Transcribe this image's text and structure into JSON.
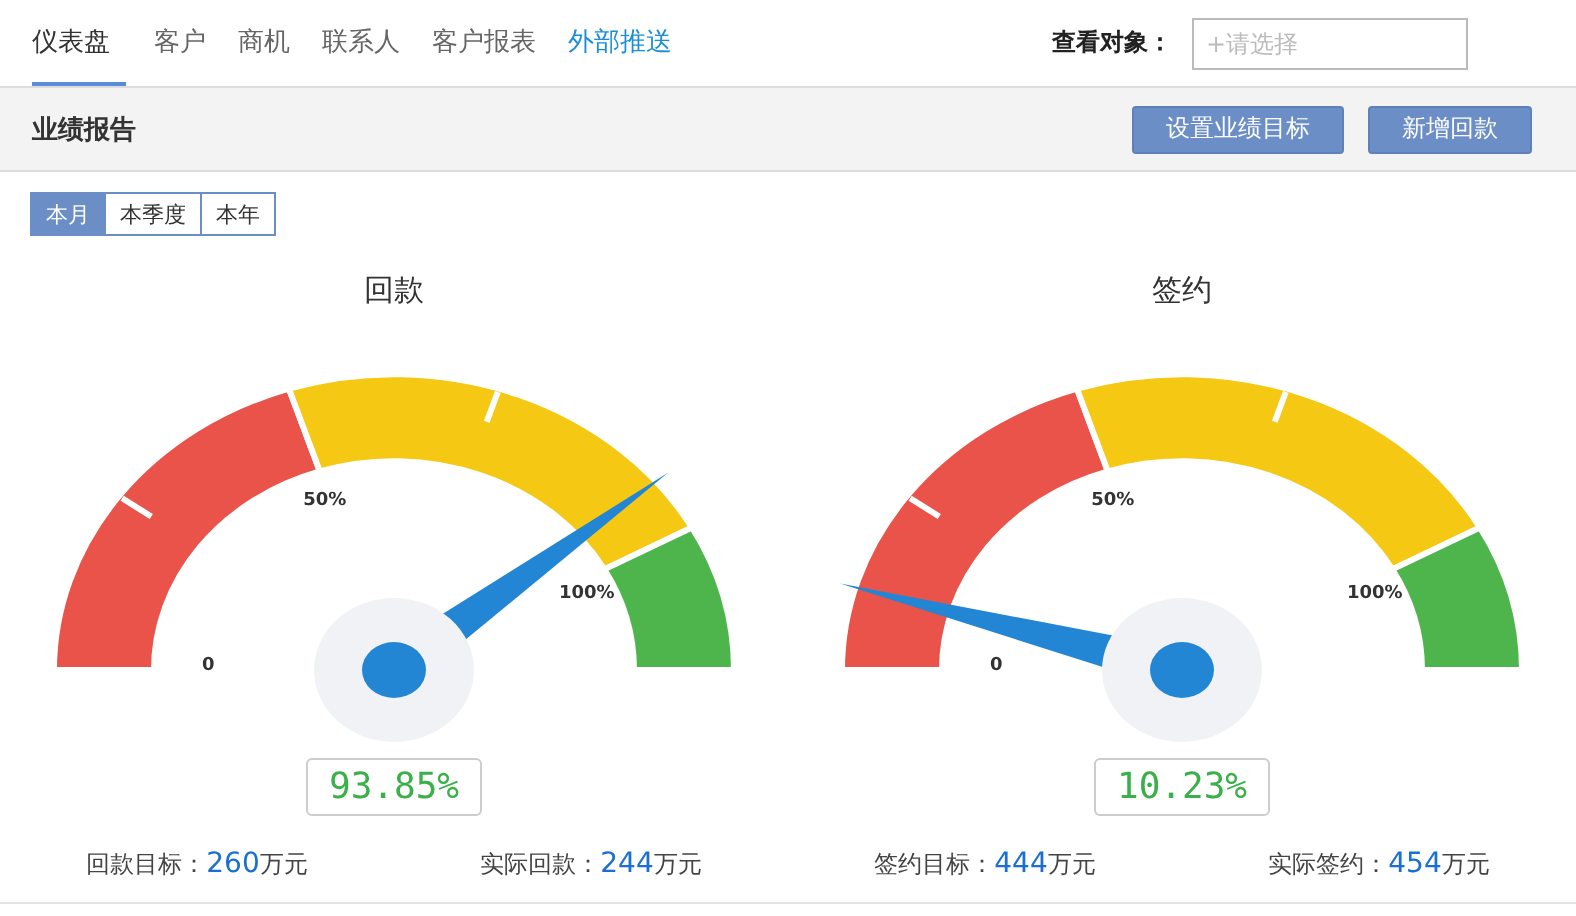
{
  "nav": {
    "tabs": [
      {
        "label": "仪表盘",
        "selected": true,
        "kind": "tab"
      },
      {
        "label": "客户",
        "selected": false,
        "kind": "tab"
      },
      {
        "label": "商机",
        "selected": false,
        "kind": "tab"
      },
      {
        "label": "联系人",
        "selected": false,
        "kind": "tab"
      },
      {
        "label": "客户报表",
        "selected": false,
        "kind": "tab"
      },
      {
        "label": "外部推送",
        "selected": false,
        "kind": "link"
      }
    ],
    "viewer_label": "查看对象：",
    "viewer_placeholder": "+请选择"
  },
  "header": {
    "title": "业绩报告",
    "buttons": [
      "设置业绩目标",
      "新增回款"
    ]
  },
  "periods": [
    {
      "label": "本月",
      "selected": true
    },
    {
      "label": "本季度",
      "selected": false
    },
    {
      "label": "本年",
      "selected": false
    }
  ],
  "gauges": [
    {
      "title": "回款",
      "tick_labels": [
        "0",
        "50%",
        "100%"
      ],
      "level": 0.78,
      "reading": "93.85%",
      "target_label": "回款目标：",
      "target_value": "260",
      "target_unit": "万元",
      "actual_label": "实际回款：",
      "actual_value": "244",
      "actual_unit": "万元"
    },
    {
      "title": "签约",
      "tick_labels": [
        "0",
        "50%",
        "100%"
      ],
      "level": 0.09,
      "reading": "10.23%",
      "target_label": "签约目标：",
      "target_value": "444",
      "target_unit": "万元",
      "actual_label": "实际签约：",
      "actual_value": "454",
      "actual_unit": "万元"
    }
  ]
}
